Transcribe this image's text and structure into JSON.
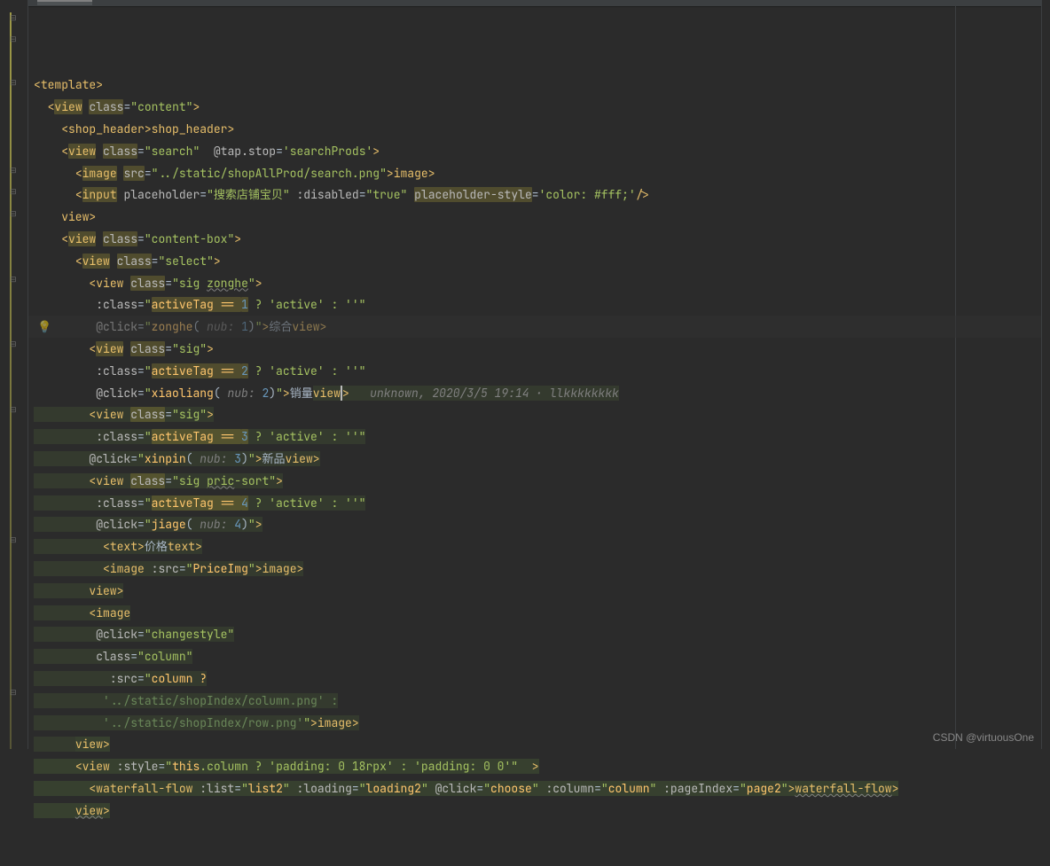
{
  "annotation": {
    "author": "unknown",
    "date": "2020/3/5 19:14",
    "user": "llkkkkkkkk"
  },
  "watermark": "CSDN @virtuousOne",
  "code": {
    "lines": [
      {
        "indent": 0,
        "k": "open",
        "tag": "template"
      },
      {
        "indent": 1,
        "k": "open",
        "tag": "view",
        "attrs": [
          [
            "class",
            "content"
          ]
        ],
        "hlTag": true,
        "hlAttr": true
      },
      {
        "indent": 2,
        "k": "selfpair",
        "tag": "shop_header"
      },
      {
        "indent": 2,
        "k": "open",
        "tag": "view",
        "attrs": [
          [
            "class",
            "search"
          ],
          [
            "@tap.stop",
            "searchProds",
            true
          ]
        ],
        "hlTag": true,
        "hlAttr": true
      },
      {
        "indent": 3,
        "k": "imgpair",
        "tag": "image",
        "attrs": [
          [
            "src",
            "../static/shopAllProd/search.png"
          ]
        ],
        "hlTag": true,
        "hlSrc": true
      },
      {
        "indent": 3,
        "k": "self",
        "tag": "input",
        "attrs": [
          [
            "placeholder",
            "搜索店铺宝贝"
          ],
          [
            ":disabled",
            "true"
          ],
          [
            "placeholder-style",
            "color: #fff;",
            true
          ]
        ],
        "hlTag": true,
        "hlPS": true
      },
      {
        "indent": 2,
        "k": "close",
        "tag": "view"
      },
      {
        "indent": 2,
        "k": "open",
        "tag": "view",
        "attrs": [
          [
            "class",
            "content-box"
          ]
        ],
        "hlTag": true,
        "hlAttr": true
      },
      {
        "indent": 3,
        "k": "open",
        "tag": "view",
        "attrs": [
          [
            "class",
            "select"
          ]
        ],
        "hlTag": true,
        "hlAttr": true
      },
      {
        "indent": 4,
        "k": "open",
        "tag": "view",
        "attrs": [
          [
            "class",
            "sig zonghe"
          ]
        ],
        "hlAttr": true,
        "wavyVal": "zonghe"
      },
      {
        "indent": 4,
        "k": "cls",
        "expr": "activeTag == ",
        "num": "1",
        "rest": " ? 'active' : ''",
        "pad": " "
      },
      {
        "indent": 4,
        "k": "click",
        "fn": "zonghe",
        "nub": "1",
        "txt": "综合",
        "closeTag": "view",
        "pad": " "
      },
      {
        "indent": 4,
        "k": "open",
        "tag": "view",
        "attrs": [
          [
            "class",
            "sig"
          ]
        ],
        "hlTag": true,
        "hlAttr": true
      },
      {
        "indent": 4,
        "k": "cls",
        "expr": "activeTag == ",
        "num": "2",
        "rest": " ? 'active' : ''",
        "pad": " "
      },
      {
        "indent": 4,
        "k": "click",
        "fn": "xiaoliang",
        "nub": "2",
        "txt": "销量",
        "closeTag": "view",
        "pad": " ",
        "cursor": true,
        "ann": true,
        "hlClose": true
      },
      {
        "indent": 4,
        "k": "open",
        "tag": "view",
        "attrs": [
          [
            "class",
            "sig"
          ]
        ],
        "hlAttr": true
      },
      {
        "indent": 4,
        "k": "cls",
        "expr": "activeTag == ",
        "num": "3",
        "rest": " ? 'active' : ''",
        "pad": " "
      },
      {
        "indent": 4,
        "k": "click",
        "fn": "xinpin",
        "nub": "3",
        "txt": "新品",
        "closeTag": "view"
      },
      {
        "indent": 4,
        "k": "open",
        "tag": "view",
        "attrs": [
          [
            "class",
            "sig pric-sort"
          ]
        ],
        "hlAttr": true,
        "wavyVal": "pric"
      },
      {
        "indent": 4,
        "k": "cls",
        "expr": "activeTag == ",
        "num": "4",
        "rest": " ? 'active' : ''",
        "pad": " "
      },
      {
        "indent": 4,
        "k": "clickOnly",
        "fn": "jiage",
        "nub": "4",
        "pad": " "
      },
      {
        "indent": 5,
        "k": "textpair",
        "tag": "text",
        "txt": "价格"
      },
      {
        "indent": 5,
        "k": "imgsrc",
        "tag": "image",
        "battr": ":src",
        "bval": "PriceImg"
      },
      {
        "indent": 4,
        "k": "close",
        "tag": "view"
      },
      {
        "indent": 4,
        "k": "opentag",
        "tag": "image"
      },
      {
        "indent": 4,
        "k": "attrline",
        "name": "@click",
        "val": "changestyle",
        "pad": " "
      },
      {
        "indent": 4,
        "k": "attrline",
        "name": "class",
        "val": "column",
        "pad": " "
      },
      {
        "indent": 5,
        "k": "srcOpen",
        "val": "column ?"
      },
      {
        "indent": 5,
        "k": "strline",
        "val": "'../static/shopIndex/column.png' :"
      },
      {
        "indent": 5,
        "k": "strclose",
        "val": "'../static/shopIndex/row.png'",
        "closeTag": "image"
      },
      {
        "indent": 3,
        "k": "close",
        "tag": "view",
        "hlg": true
      },
      {
        "indent": 3,
        "k": "open",
        "tag": "view",
        "attrs": [
          [
            ":style",
            "this.column ? 'padding: 0 18rpx' : 'padding: 0 0'"
          ]
        ],
        "gt": "  >",
        "fnThis": true
      },
      {
        "indent": 4,
        "k": "wf",
        "tag": "waterfall-flow",
        "attrs": [
          [
            ":list",
            "list2"
          ],
          [
            ":loading",
            "loading2"
          ],
          [
            "@click",
            "choose"
          ],
          [
            ":column",
            "column"
          ],
          [
            ":pageIndex",
            "page2"
          ]
        ]
      },
      {
        "indent": 3,
        "k": "closeWavy",
        "tag": "view"
      }
    ]
  }
}
